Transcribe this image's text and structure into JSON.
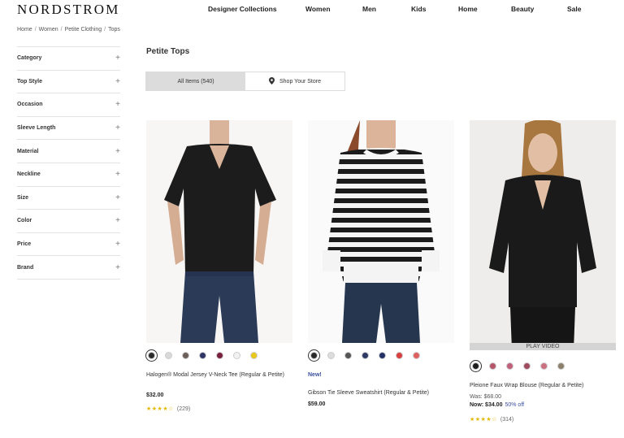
{
  "brand": "NORDSTROM",
  "nav": [
    "Designer Collections",
    "Women",
    "Men",
    "Kids",
    "Home",
    "Beauty",
    "Sale"
  ],
  "breadcrumb": [
    "Home",
    "Women",
    "Petite Clothing",
    "Tops"
  ],
  "filters": [
    "Category",
    "Top Style",
    "Occasion",
    "Sleeve Length",
    "Material",
    "Neckline",
    "Size",
    "Color",
    "Price",
    "Brand"
  ],
  "filter_expand_icon": "plus-icon",
  "heading": "Petite Tops",
  "toggle": {
    "all_items": "All Items (540)",
    "shop_store": "Shop Your Store",
    "store_icon": "map-pin-icon"
  },
  "products": [
    {
      "name": "Halogen® Modal Jersey V-Neck Tee (Regular & Petite)",
      "price": "$32.00",
      "rating_stars": "★★★★☆",
      "rating_value": 4.5,
      "reviews": "(229)",
      "swatches": [
        "#2a2a2a",
        "#d9d9d9",
        "#6b5f58",
        "#2c3566",
        "#7a1f3d",
        "#f2f2f2",
        "#e8c81a"
      ]
    },
    {
      "new_tag": "New!",
      "name": "Gibson Tie Sleeve Sweatshirt (Regular & Petite)",
      "price": "$59.00",
      "swatches": [
        "#2a2a2a",
        "#dcdcdc",
        "#555555",
        "#2e3a66",
        "#223066",
        "#d94040",
        "#e06060"
      ]
    },
    {
      "name": "Pleione Faux Wrap Blouse (Regular & Petite)",
      "was": "Was: $68.00",
      "now": "Now: $34.00",
      "off": "50% off",
      "play_video": "PLAY VIDEO",
      "rating_stars": "★★★★☆",
      "rating_value": 4,
      "reviews": "(314)",
      "swatches": [
        "#1e1e1e",
        "#b5566a",
        "#c0607a",
        "#a04a5e",
        "#cc7080",
        "#8c7f6c"
      ]
    }
  ]
}
